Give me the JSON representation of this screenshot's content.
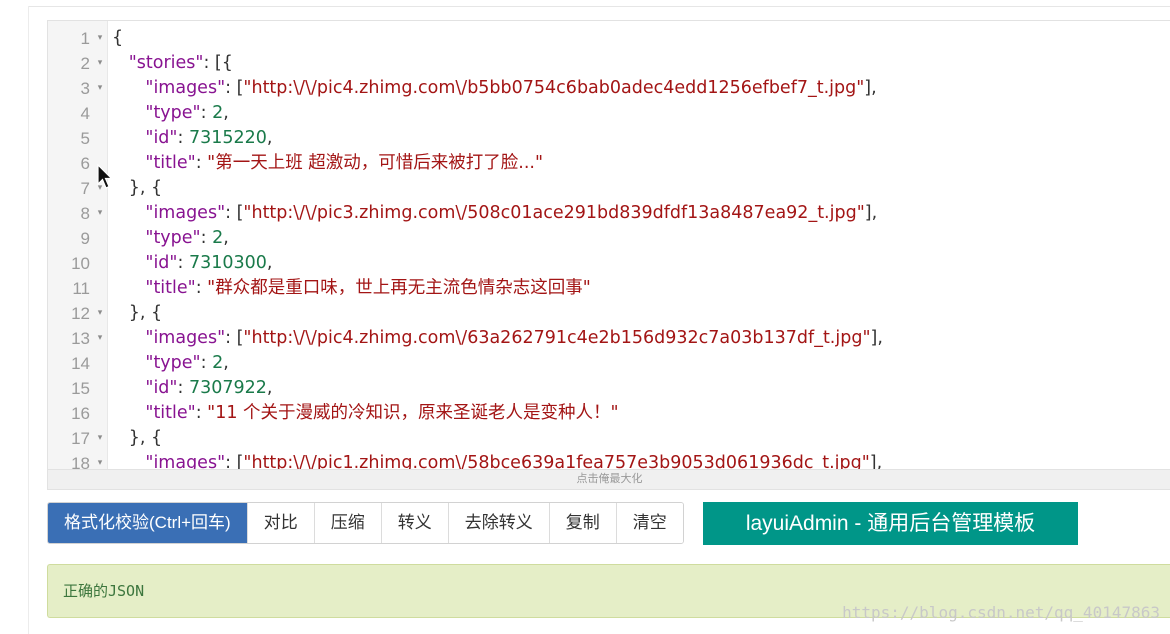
{
  "editor": {
    "resize_hint": "点击俺最大化",
    "lines": [
      {
        "num": "1",
        "fold": "▾",
        "parts": [
          {
            "c": "p",
            "t": "{"
          }
        ]
      },
      {
        "num": "2",
        "fold": "▾",
        "parts": [
          {
            "c": "p",
            "t": "   "
          },
          {
            "c": "k",
            "t": "\"stories\""
          },
          {
            "c": "p",
            "t": ": [{"
          }
        ]
      },
      {
        "num": "3",
        "fold": "▾",
        "parts": [
          {
            "c": "p",
            "t": "      "
          },
          {
            "c": "k",
            "t": "\"images\""
          },
          {
            "c": "p",
            "t": ": ["
          },
          {
            "c": "s",
            "t": "\"http:\\/\\/pic4.zhimg.com\\/b5bb0754c6bab0adec4edd1256efbef7_t.jpg\""
          },
          {
            "c": "p",
            "t": "],"
          }
        ]
      },
      {
        "num": "4",
        "fold": "",
        "parts": [
          {
            "c": "p",
            "t": "      "
          },
          {
            "c": "k",
            "t": "\"type\""
          },
          {
            "c": "p",
            "t": ": "
          },
          {
            "c": "n",
            "t": "2"
          },
          {
            "c": "p",
            "t": ","
          }
        ]
      },
      {
        "num": "5",
        "fold": "",
        "parts": [
          {
            "c": "p",
            "t": "      "
          },
          {
            "c": "k",
            "t": "\"id\""
          },
          {
            "c": "p",
            "t": ": "
          },
          {
            "c": "n",
            "t": "7315220"
          },
          {
            "c": "p",
            "t": ","
          }
        ]
      },
      {
        "num": "6",
        "fold": "",
        "parts": [
          {
            "c": "p",
            "t": "      "
          },
          {
            "c": "k",
            "t": "\"title\""
          },
          {
            "c": "p",
            "t": ": "
          },
          {
            "c": "s",
            "t": "\"第一天上班 超激动，可惜后来被打了脸...\""
          }
        ]
      },
      {
        "num": "7",
        "fold": "▾",
        "parts": [
          {
            "c": "p",
            "t": "   }, {"
          }
        ]
      },
      {
        "num": "8",
        "fold": "▾",
        "parts": [
          {
            "c": "p",
            "t": "      "
          },
          {
            "c": "k",
            "t": "\"images\""
          },
          {
            "c": "p",
            "t": ": ["
          },
          {
            "c": "s",
            "t": "\"http:\\/\\/pic3.zhimg.com\\/508c01ace291bd839dfdf13a8487ea92_t.jpg\""
          },
          {
            "c": "p",
            "t": "],"
          }
        ]
      },
      {
        "num": "9",
        "fold": "",
        "parts": [
          {
            "c": "p",
            "t": "      "
          },
          {
            "c": "k",
            "t": "\"type\""
          },
          {
            "c": "p",
            "t": ": "
          },
          {
            "c": "n",
            "t": "2"
          },
          {
            "c": "p",
            "t": ","
          }
        ]
      },
      {
        "num": "10",
        "fold": "",
        "parts": [
          {
            "c": "p",
            "t": "      "
          },
          {
            "c": "k",
            "t": "\"id\""
          },
          {
            "c": "p",
            "t": ": "
          },
          {
            "c": "n",
            "t": "7310300"
          },
          {
            "c": "p",
            "t": ","
          }
        ]
      },
      {
        "num": "11",
        "fold": "",
        "parts": [
          {
            "c": "p",
            "t": "      "
          },
          {
            "c": "k",
            "t": "\"title\""
          },
          {
            "c": "p",
            "t": ": "
          },
          {
            "c": "s",
            "t": "\"群众都是重口味，世上再无主流色情杂志这回事\""
          }
        ]
      },
      {
        "num": "12",
        "fold": "▾",
        "parts": [
          {
            "c": "p",
            "t": "   }, {"
          }
        ]
      },
      {
        "num": "13",
        "fold": "▾",
        "parts": [
          {
            "c": "p",
            "t": "      "
          },
          {
            "c": "k",
            "t": "\"images\""
          },
          {
            "c": "p",
            "t": ": ["
          },
          {
            "c": "s",
            "t": "\"http:\\/\\/pic4.zhimg.com\\/63a262791c4e2b156d932c7a03b137df_t.jpg\""
          },
          {
            "c": "p",
            "t": "],"
          }
        ]
      },
      {
        "num": "14",
        "fold": "",
        "parts": [
          {
            "c": "p",
            "t": "      "
          },
          {
            "c": "k",
            "t": "\"type\""
          },
          {
            "c": "p",
            "t": ": "
          },
          {
            "c": "n",
            "t": "2"
          },
          {
            "c": "p",
            "t": ","
          }
        ]
      },
      {
        "num": "15",
        "fold": "",
        "parts": [
          {
            "c": "p",
            "t": "      "
          },
          {
            "c": "k",
            "t": "\"id\""
          },
          {
            "c": "p",
            "t": ": "
          },
          {
            "c": "n",
            "t": "7307922"
          },
          {
            "c": "p",
            "t": ","
          }
        ]
      },
      {
        "num": "16",
        "fold": "",
        "parts": [
          {
            "c": "p",
            "t": "      "
          },
          {
            "c": "k",
            "t": "\"title\""
          },
          {
            "c": "p",
            "t": ": "
          },
          {
            "c": "s",
            "t": "\"11 个关于漫威的冷知识，原来圣诞老人是变种人！\""
          }
        ]
      },
      {
        "num": "17",
        "fold": "▾",
        "parts": [
          {
            "c": "p",
            "t": "   }, {"
          }
        ]
      },
      {
        "num": "18",
        "fold": "▾",
        "parts": [
          {
            "c": "p",
            "t": "      "
          },
          {
            "c": "k",
            "t": "\"images\""
          },
          {
            "c": "p",
            "t": ": ["
          },
          {
            "c": "s",
            "t": "\"http:\\/\\/pic1.zhimg.com\\/58bce639a1fea757e3b9053d061936dc_t.jpg\""
          },
          {
            "c": "p",
            "t": "],"
          }
        ]
      }
    ]
  },
  "toolbar": {
    "format_label": "格式化校验(Ctrl+回车)",
    "compare_label": "对比",
    "compress_label": "压缩",
    "escape_label": "转义",
    "unescape_label": "去除转义",
    "copy_label": "复制",
    "clear_label": "清空"
  },
  "admin_button": {
    "label": "layuiAdmin - 通用后台管理模板"
  },
  "result": {
    "message": "正确的JSON"
  },
  "watermark": {
    "text": "https://blog.csdn.net/qq_40147863"
  },
  "colors": {
    "primary": "#3a6fb5",
    "admin": "#009688",
    "success_bg": "#e5eec7",
    "success_text": "#3c763d"
  }
}
